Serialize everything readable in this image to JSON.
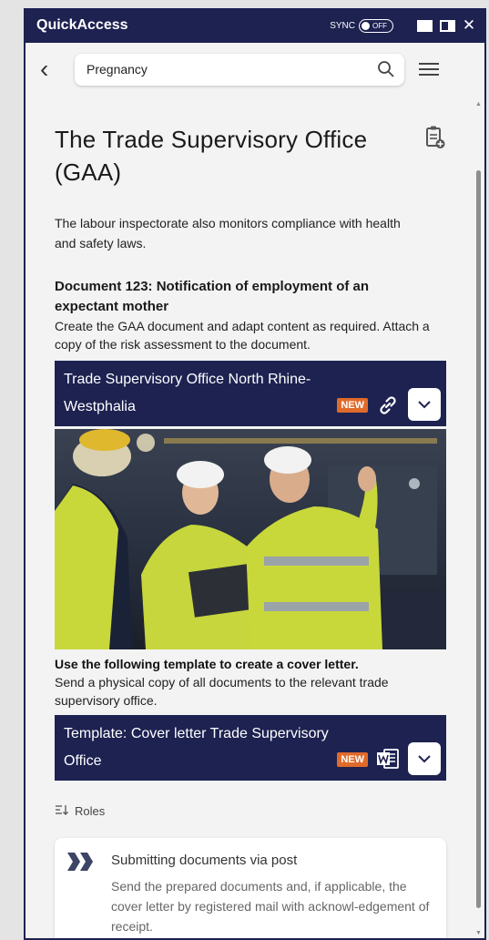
{
  "titlebar": {
    "app_title": "QuickAccess",
    "sync_label": "SYNC",
    "sync_state": "OFF",
    "close_glyph": "✕"
  },
  "topbar": {
    "back_glyph": "‹",
    "search_value": "Pregnancy"
  },
  "page": {
    "heading": "The Trade Supervisory Office (GAA)",
    "intro": "The labour inspectorate also monitors compliance with health and safety laws."
  },
  "document": {
    "title": "Document 123: Notification of employment of an expectant mother",
    "text": "Create the GAA document and adapt content as required. Attach a copy of the risk assessment to the document."
  },
  "card_office": {
    "title": "Trade Supervisory Office North Rhine-Westphalia",
    "badge": "NEW"
  },
  "template_section": {
    "bold": "Use the following template to create a cover letter.",
    "text": "Send a physical copy of all documents to the relevant trade supervisory office."
  },
  "card_template": {
    "title": "Template: Cover letter Trade Supervisory Office",
    "badge": "NEW"
  },
  "roles": {
    "label": "Roles"
  },
  "info": {
    "title": "Submitting documents via post",
    "text": "Send the prepared documents and, if applicable, the cover letter by registered mail with acknowl-edgement of receipt."
  },
  "colors": {
    "navy": "#1d2251",
    "badge_orange": "#e06a2a",
    "background": "#f3f3f3"
  },
  "icons": [
    "back-icon",
    "search-icon",
    "menu-icon",
    "clipboard-add-icon",
    "link-icon",
    "word-document-icon",
    "chevron-down-icon",
    "sort-icon",
    "quote-icon"
  ]
}
